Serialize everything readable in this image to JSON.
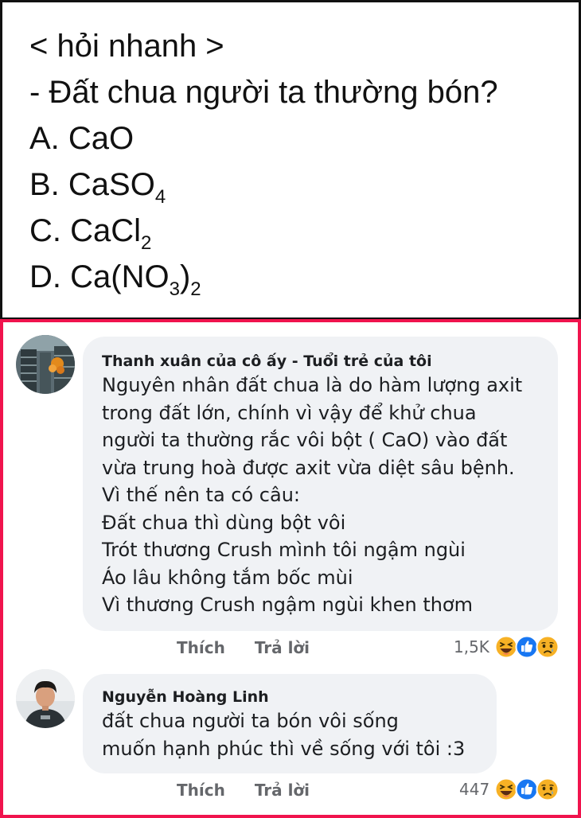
{
  "quiz": {
    "header": "< hỏi nhanh >",
    "question": "- Đất chua người ta thường bón?",
    "option_a": "A. CaO",
    "option_b_prefix": "B. CaSO",
    "option_b_sub": "4",
    "option_c_prefix": "C. CaCl",
    "option_c_sub": "2",
    "option_d_prefix": "D. Ca(NO",
    "option_d_sub_inner": "3",
    "option_d_close": ")",
    "option_d_sub_outer": "2"
  },
  "comments": [
    {
      "author": "Thanh xuân của cô ấy - Tuổi trẻ của tôi",
      "lines": [
        "Nguyên nhân đất chua là do hàm lượng axit",
        "trong đất lớn, chính vì vậy để khử chua",
        "người ta thường rắc vôi bột  ( CaO) vào đất",
        "vừa trung hoà được axit vừa diệt sâu bệnh.",
        "Vì thế nên ta có câu:",
        "Đất chua thì dùng bột vôi",
        "Trót thương Crush mình tôi ngậm ngùi",
        "Áo lâu không tắm bốc mùi",
        "Vì thương Crush ngậm ngùi khen thơm"
      ],
      "like_label": "Thích",
      "reply_label": "Trả lời",
      "reaction_count": "1,5K",
      "reactions": [
        "haha-icon",
        "like-icon",
        "sad-icon"
      ]
    },
    {
      "author": "Nguyễn Hoàng Linh",
      "lines": [
        "đất chua người ta bón vôi sống",
        "muốn hạnh phúc thì về sống với tôi :3"
      ],
      "like_label": "Thích",
      "reply_label": "Trả lời",
      "reaction_count": "447",
      "reactions": [
        "haha-icon",
        "like-icon",
        "sad-icon"
      ]
    }
  ],
  "colors": {
    "highlight_border": "#f0134d",
    "bubble": "#f0f2f5",
    "action_text": "#65676b",
    "like_blue": "#1877f2",
    "emoji_yellow": "#f7b125"
  }
}
